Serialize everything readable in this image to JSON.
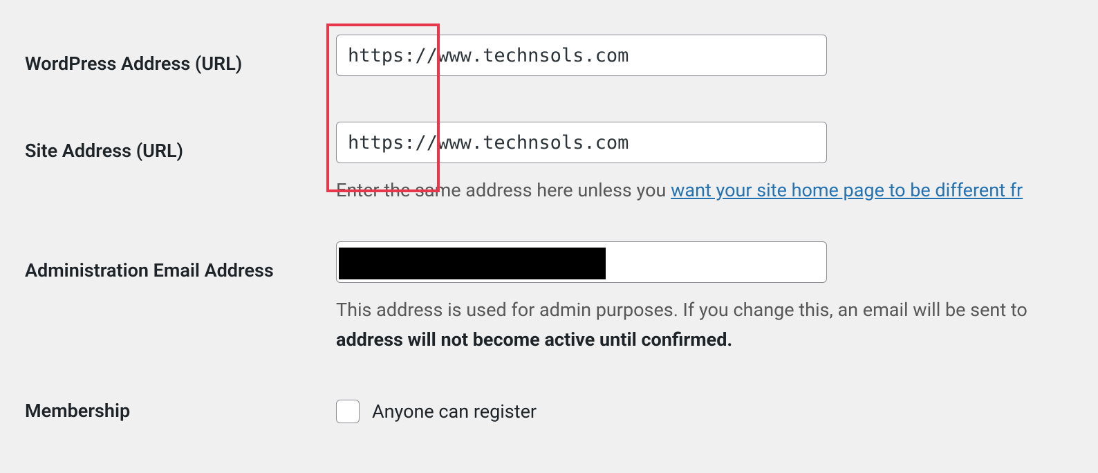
{
  "settings": {
    "wp_address": {
      "label": "WordPress Address (URL)",
      "value": "https://www.technsols.com"
    },
    "site_address": {
      "label": "Site Address (URL)",
      "value": "https://www.technsols.com",
      "help_prefix": "Enter the same address here unless you ",
      "help_link": "want your site home page to be different fr"
    },
    "admin_email": {
      "label": "Administration Email Address",
      "value": "",
      "help_prefix": "This address is used for admin purposes. If you change this, an email will be sent to",
      "help_strong": "address will not become active until confirmed."
    },
    "membership": {
      "label": "Membership",
      "checkbox_label": "Anyone can register",
      "checked": false
    }
  }
}
